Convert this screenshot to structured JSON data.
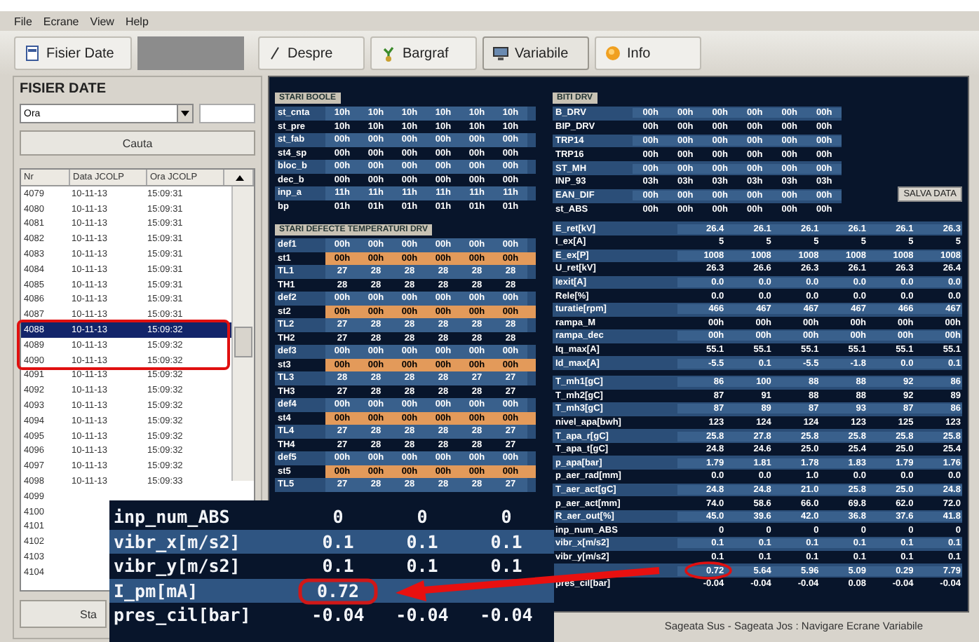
{
  "menu": [
    "File",
    "Ecrane",
    "View",
    "Help"
  ],
  "toolbar": {
    "file_button": "Fisier Date",
    "tabs": [
      {
        "label": "Despre",
        "selected": false
      },
      {
        "label": "Bargraf",
        "selected": false
      },
      {
        "label": "Variabile",
        "selected": true
      },
      {
        "label": "Info",
        "selected": false
      }
    ]
  },
  "file_panel": {
    "title": "FISIER DATE",
    "combo_value": "Ora",
    "search_button": "Cauta",
    "columns": [
      "Nr",
      "Data JCOLP",
      "Ora JCOLP"
    ],
    "rows": [
      {
        "nr": "4079",
        "date": "10-11-13",
        "time": "15:09:31",
        "selected": false
      },
      {
        "nr": "4080",
        "date": "10-11-13",
        "time": "15:09:31",
        "selected": false
      },
      {
        "nr": "4081",
        "date": "10-11-13",
        "time": "15:09:31",
        "selected": false
      },
      {
        "nr": "4082",
        "date": "10-11-13",
        "time": "15:09:31",
        "selected": false
      },
      {
        "nr": "4083",
        "date": "10-11-13",
        "time": "15:09:31",
        "selected": false
      },
      {
        "nr": "4084",
        "date": "10-11-13",
        "time": "15:09:31",
        "selected": false
      },
      {
        "nr": "4085",
        "date": "10-11-13",
        "time": "15:09:31",
        "selected": false
      },
      {
        "nr": "4086",
        "date": "10-11-13",
        "time": "15:09:31",
        "selected": false
      },
      {
        "nr": "4087",
        "date": "10-11-13",
        "time": "15:09:31",
        "selected": false
      },
      {
        "nr": "4088",
        "date": "10-11-13",
        "time": "15:09:32",
        "selected": true
      },
      {
        "nr": "4089",
        "date": "10-11-13",
        "time": "15:09:32",
        "selected": false
      },
      {
        "nr": "4090",
        "date": "10-11-13",
        "time": "15:09:32",
        "selected": false
      },
      {
        "nr": "4091",
        "date": "10-11-13",
        "time": "15:09:32",
        "selected": false
      },
      {
        "nr": "4092",
        "date": "10-11-13",
        "time": "15:09:32",
        "selected": false
      },
      {
        "nr": "4093",
        "date": "10-11-13",
        "time": "15:09:32",
        "selected": false
      },
      {
        "nr": "4094",
        "date": "10-11-13",
        "time": "15:09:32",
        "selected": false
      },
      {
        "nr": "4095",
        "date": "10-11-13",
        "time": "15:09:32",
        "selected": false
      },
      {
        "nr": "4096",
        "date": "10-11-13",
        "time": "15:09:32",
        "selected": false
      },
      {
        "nr": "4097",
        "date": "10-11-13",
        "time": "15:09:32",
        "selected": false
      },
      {
        "nr": "4098",
        "date": "10-11-13",
        "time": "15:09:33",
        "selected": false
      },
      {
        "nr": "4099",
        "selected": false
      },
      {
        "nr": "4100",
        "selected": false
      },
      {
        "nr": "4101",
        "selected": false
      },
      {
        "nr": "4102",
        "selected": false
      },
      {
        "nr": "4103",
        "selected": false
      },
      {
        "nr": "4104",
        "selected": false
      }
    ],
    "start_button": "Sta"
  },
  "status_section": {
    "title": "STARI BOOLE",
    "rows": [
      {
        "label": "st_cnta",
        "values": [
          "10h",
          "10h",
          "10h",
          "10h",
          "10h",
          "10h"
        ]
      },
      {
        "label": "st_pre",
        "values": [
          "10h",
          "10h",
          "10h",
          "10h",
          "10h",
          "10h"
        ]
      },
      {
        "label": "st_fab",
        "values": [
          "00h",
          "00h",
          "00h",
          "00h",
          "00h",
          "00h"
        ]
      },
      {
        "label": "st4_sp",
        "values": [
          "00h",
          "00h",
          "00h",
          "00h",
          "00h",
          "00h"
        ]
      },
      {
        "label": "bloc_b",
        "values": [
          "00h",
          "00h",
          "00h",
          "00h",
          "00h",
          "00h"
        ]
      },
      {
        "label": "dec_b",
        "values": [
          "00h",
          "00h",
          "00h",
          "00h",
          "00h",
          "00h"
        ]
      },
      {
        "label": "inp_a",
        "values": [
          "11h",
          "11h",
          "11h",
          "11h",
          "11h",
          "11h"
        ]
      },
      {
        "label": "bp",
        "values": [
          "01h",
          "01h",
          "01h",
          "01h",
          "01h",
          "01h"
        ]
      }
    ]
  },
  "fault_section": {
    "title": "STARI DEFECTE TEMPERATURI DRV",
    "rows": [
      {
        "label": "def1",
        "kind": "value",
        "values": [
          "00h",
          "00h",
          "00h",
          "00h",
          "00h",
          "00h"
        ]
      },
      {
        "label": "st1",
        "kind": "alert",
        "values": [
          "00h",
          "00h",
          "00h",
          "00h",
          "00h",
          "00h"
        ]
      },
      {
        "label": "TL1",
        "kind": "value",
        "values": [
          "27",
          "28",
          "28",
          "28",
          "28",
          "28"
        ]
      },
      {
        "label": "TH1",
        "kind": "value",
        "values": [
          "28",
          "28",
          "28",
          "28",
          "28",
          "28"
        ]
      },
      {
        "label": "def2",
        "kind": "value",
        "values": [
          "00h",
          "00h",
          "00h",
          "00h",
          "00h",
          "00h"
        ]
      },
      {
        "label": "st2",
        "kind": "alert",
        "values": [
          "00h",
          "00h",
          "00h",
          "00h",
          "00h",
          "00h"
        ]
      },
      {
        "label": "TL2",
        "kind": "value",
        "values": [
          "27",
          "28",
          "28",
          "28",
          "28",
          "28"
        ]
      },
      {
        "label": "TH2",
        "kind": "value",
        "values": [
          "27",
          "28",
          "28",
          "28",
          "28",
          "28"
        ]
      },
      {
        "label": "def3",
        "kind": "value",
        "values": [
          "00h",
          "00h",
          "00h",
          "00h",
          "00h",
          "00h"
        ]
      },
      {
        "label": "st3",
        "kind": "alert",
        "values": [
          "00h",
          "00h",
          "00h",
          "00h",
          "00h",
          "00h"
        ]
      },
      {
        "label": "TL3",
        "kind": "value",
        "values": [
          "28",
          "28",
          "28",
          "28",
          "27",
          "27"
        ]
      },
      {
        "label": "TH3",
        "kind": "value",
        "values": [
          "27",
          "28",
          "28",
          "28",
          "28",
          "27"
        ]
      },
      {
        "label": "def4",
        "kind": "value",
        "values": [
          "00h",
          "00h",
          "00h",
          "00h",
          "00h",
          "00h"
        ]
      },
      {
        "label": "st4",
        "kind": "alert",
        "values": [
          "00h",
          "00h",
          "00h",
          "00h",
          "00h",
          "00h"
        ]
      },
      {
        "label": "TL4",
        "kind": "value",
        "values": [
          "27",
          "28",
          "28",
          "28",
          "28",
          "27"
        ]
      },
      {
        "label": "TH4",
        "kind": "value",
        "values": [
          "27",
          "28",
          "28",
          "28",
          "28",
          "27"
        ]
      },
      {
        "label": "def5",
        "kind": "value",
        "values": [
          "00h",
          "00h",
          "00h",
          "00h",
          "00h",
          "00h"
        ]
      },
      {
        "label": "st5",
        "kind": "alert",
        "values": [
          "00h",
          "00h",
          "00h",
          "00h",
          "00h",
          "00h"
        ]
      },
      {
        "label": "TL5",
        "kind": "value",
        "values": [
          "27",
          "28",
          "28",
          "28",
          "28",
          "27"
        ]
      }
    ]
  },
  "bits_section": {
    "title": "BITI DRV",
    "save_button": "SALVA DATA",
    "rows": [
      {
        "label": "B_DRV",
        "values": [
          "00h",
          "00h",
          "00h",
          "00h",
          "00h",
          "00h"
        ]
      },
      {
        "label": "BIP_DRV",
        "values": [
          "00h",
          "00h",
          "00h",
          "00h",
          "00h",
          "00h"
        ]
      },
      {
        "label": "TRP14",
        "values": [
          "00h",
          "00h",
          "00h",
          "00h",
          "00h",
          "00h"
        ]
      },
      {
        "label": "TRP16",
        "values": [
          "00h",
          "00h",
          "00h",
          "00h",
          "00h",
          "00h"
        ]
      },
      {
        "label": "ST_MH",
        "values": [
          "00h",
          "00h",
          "00h",
          "00h",
          "00h",
          "00h"
        ]
      },
      {
        "label": "INP_93",
        "values": [
          "03h",
          "03h",
          "03h",
          "03h",
          "03h",
          "03h"
        ]
      },
      {
        "label": "EAN_DIF",
        "values": [
          "00h",
          "00h",
          "00h",
          "00h",
          "00h",
          "00h"
        ]
      },
      {
        "label": "st_ABS",
        "values": [
          "00h",
          "00h",
          "00h",
          "00h",
          "00h",
          "00h"
        ]
      }
    ]
  },
  "analog_groups": [
    [
      {
        "label": "E_ret[kV]",
        "values": [
          "26.4",
          "26.1",
          "26.1",
          "26.1",
          "26.1",
          "26.3"
        ]
      },
      {
        "label": "I_ex[A]",
        "values": [
          "5",
          "5",
          "5",
          "5",
          "5",
          "5"
        ]
      },
      {
        "label": "E_ex[P]",
        "values": [
          "1008",
          "1008",
          "1008",
          "1008",
          "1008",
          "1008"
        ]
      },
      {
        "label": "U_ret[kV]",
        "values": [
          "26.3",
          "26.6",
          "26.3",
          "26.1",
          "26.3",
          "26.4"
        ]
      },
      {
        "label": "Iexit[A]",
        "values": [
          "0.0",
          "0.0",
          "0.0",
          "0.0",
          "0.0",
          "0.0"
        ]
      },
      {
        "label": "Rele[%]",
        "values": [
          "0.0",
          "0.0",
          "0.0",
          "0.0",
          "0.0",
          "0.0"
        ]
      },
      {
        "label": "turatie[rpm]",
        "values": [
          "466",
          "467",
          "467",
          "467",
          "466",
          "467"
        ]
      },
      {
        "label": "rampa_M",
        "values": [
          "00h",
          "00h",
          "00h",
          "00h",
          "00h",
          "00h"
        ]
      },
      {
        "label": "rampa_dec",
        "values": [
          "00h",
          "00h",
          "00h",
          "00h",
          "00h",
          "00h"
        ]
      },
      {
        "label": "Iq_max[A]",
        "values": [
          "55.1",
          "55.1",
          "55.1",
          "55.1",
          "55.1",
          "55.1"
        ]
      },
      {
        "label": "Id_max[A]",
        "values": [
          "-5.5",
          "0.1",
          "-5.5",
          "-1.8",
          "0.0",
          "0.1"
        ]
      }
    ],
    [
      {
        "label": "T_mh1[gC]",
        "values": [
          "86",
          "100",
          "88",
          "88",
          "92",
          "86"
        ]
      },
      {
        "label": "T_mh2[gC]",
        "values": [
          "87",
          "91",
          "88",
          "88",
          "92",
          "89"
        ]
      },
      {
        "label": "T_mh3[gC]",
        "values": [
          "87",
          "89",
          "87",
          "93",
          "87",
          "86"
        ]
      },
      {
        "label": "nivel_apa[bwh]",
        "values": [
          "123",
          "124",
          "124",
          "123",
          "125",
          "123"
        ]
      },
      {
        "label": "T_apa_r[gC]",
        "values": [
          "25.8",
          "27.8",
          "25.8",
          "25.8",
          "25.8",
          "25.8"
        ]
      },
      {
        "label": "T_apa_t[gC]",
        "values": [
          "24.8",
          "24.6",
          "25.0",
          "25.4",
          "25.0",
          "25.4"
        ]
      },
      {
        "label": "p_apa[bar]",
        "values": [
          "1.79",
          "1.81",
          "1.78",
          "1.83",
          "1.79",
          "1.76"
        ]
      },
      {
        "label": "p_aer_rad[mm]",
        "values": [
          "0.0",
          "0.0",
          "1.0",
          "0.0",
          "0.0",
          "0.0"
        ]
      },
      {
        "label": "T_aer_act[gC]",
        "values": [
          "24.8",
          "24.8",
          "21.0",
          "25.8",
          "25.0",
          "24.8"
        ]
      },
      {
        "label": "p_aer_act[mm]",
        "values": [
          "74.0",
          "58.6",
          "66.0",
          "69.8",
          "62.0",
          "72.0"
        ]
      },
      {
        "label": "R_aer_out[%]",
        "values": [
          "45.0",
          "39.6",
          "42.0",
          "36.8",
          "37.6",
          "41.8"
        ]
      },
      {
        "label": "inp_num_ABS",
        "values": [
          "0",
          "0",
          "0",
          "0",
          "0",
          "0"
        ]
      },
      {
        "label": "vibr_x[m/s2]",
        "values": [
          "0.1",
          "0.1",
          "0.1",
          "0.1",
          "0.1",
          "0.1"
        ]
      },
      {
        "label": "vibr_y[m/s2]",
        "values": [
          "0.1",
          "0.1",
          "0.1",
          "0.1",
          "0.1",
          "0.1"
        ]
      },
      {
        "values": [
          "0.72",
          "5.64",
          "5.96",
          "5.09",
          "0.29",
          "7.79"
        ]
      },
      {
        "label": "pres_cil[bar]",
        "values": [
          "-0.04",
          "-0.04",
          "-0.04",
          "0.08",
          "-0.04",
          "-0.04"
        ]
      }
    ]
  ],
  "status_bar": "Sageata Sus - Sageata Jos : Navigare Ecrane Variabile",
  "magnifier": {
    "rows": [
      {
        "label": "inp_num_ABS",
        "values": [
          "0",
          "0",
          "0"
        ]
      },
      {
        "label": "vibr_x[m/s2]",
        "values": [
          "0.1",
          "0.1",
          "0.1"
        ]
      },
      {
        "label": "vibr_y[m/s2]",
        "values": [
          "0.1",
          "0.1",
          "0.1"
        ]
      },
      {
        "label": "I_pm[mA]",
        "values": [
          "0.72"
        ]
      },
      {
        "label": "pres_cil[bar]",
        "values": [
          "-0.04",
          "-0.04",
          "-0.04"
        ]
      }
    ]
  }
}
